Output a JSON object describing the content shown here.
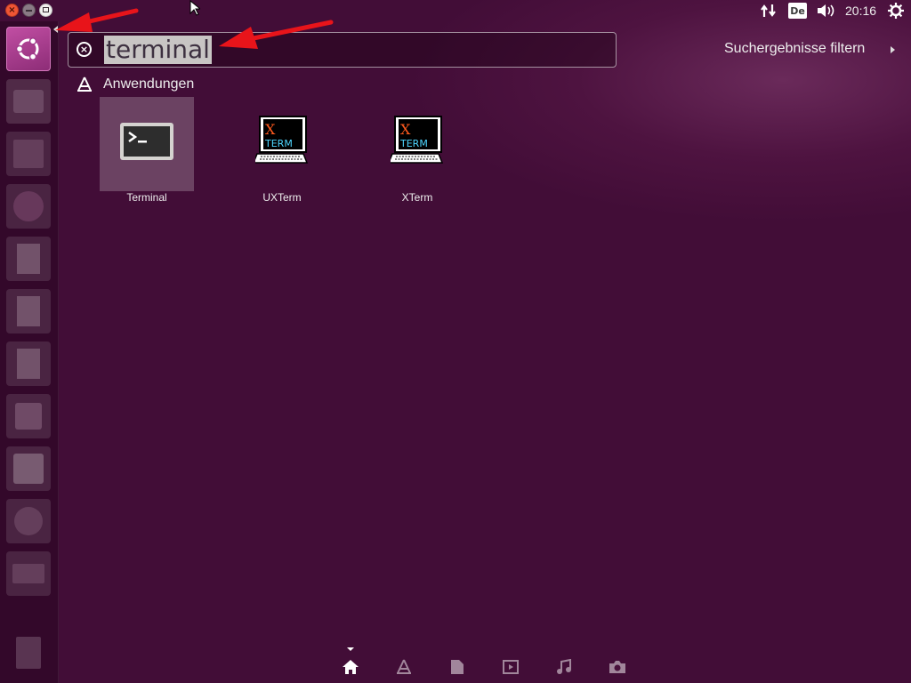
{
  "window_controls": {
    "close_icon": "close-icon",
    "minimize_icon": "minimize-icon",
    "maximize_icon": "maximize-icon"
  },
  "tray": {
    "keyboard_layout": "De",
    "time": "20:16",
    "icons": [
      "network-transfer-icon",
      "volume-icon",
      "power-gear-icon"
    ]
  },
  "launcher": {
    "items": [
      {
        "name": "dash-home",
        "icon": "ubuntu-logo-icon"
      },
      {
        "name": "system-installer",
        "icon": "installer-icon"
      },
      {
        "name": "files",
        "icon": "file-cabinet-icon"
      },
      {
        "name": "firefox",
        "icon": "firefox-icon"
      },
      {
        "name": "libreoffice-writer",
        "icon": "document-icon"
      },
      {
        "name": "libreoffice-calc",
        "icon": "spreadsheet-icon"
      },
      {
        "name": "libreoffice-impress",
        "icon": "presentation-icon"
      },
      {
        "name": "software-center",
        "icon": "shopping-bag-icon"
      },
      {
        "name": "amazon",
        "icon": "amazon-icon"
      },
      {
        "name": "system-settings",
        "icon": "settings-icon"
      },
      {
        "name": "drive",
        "icon": "drive-icon"
      },
      {
        "name": "trash",
        "icon": "trash-icon"
      }
    ]
  },
  "search": {
    "value": "terminal",
    "filter_label": "Suchergebnisse filtern"
  },
  "results": {
    "category_title": "Anwendungen",
    "apps": [
      {
        "label": "Terminal",
        "selected": true
      },
      {
        "label": "UXTerm",
        "selected": false
      },
      {
        "label": "XTerm",
        "selected": false
      }
    ]
  },
  "xterm_logo": {
    "x": "X",
    "term": "TERM"
  },
  "lenses": [
    "home-icon",
    "applications-icon",
    "files-icon",
    "video-icon",
    "music-icon",
    "photo-icon"
  ],
  "colors": {
    "background": "#440e39",
    "accent": "#c14ea3",
    "annotation_arrow": "#e8141a"
  }
}
